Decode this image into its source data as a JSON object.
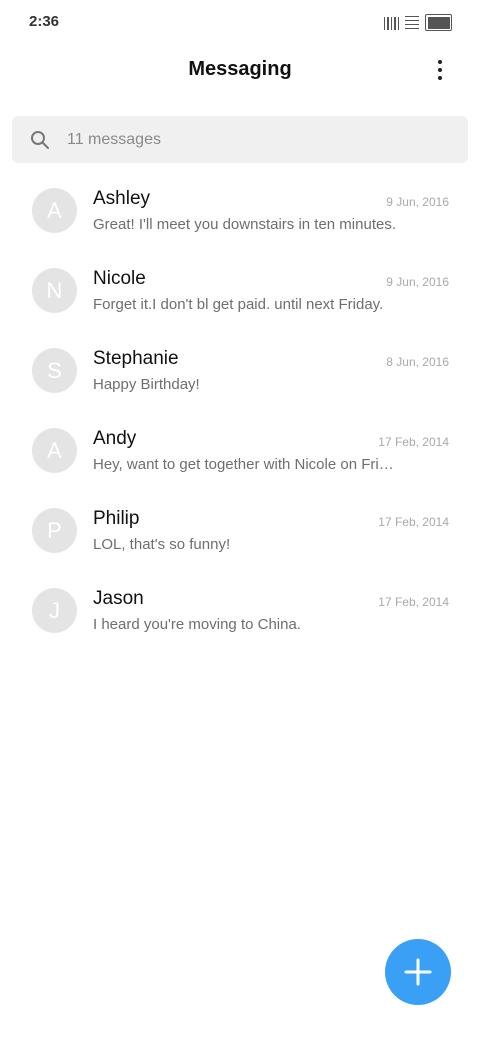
{
  "status_bar": {
    "time": "2:36",
    "icons": [
      "signal-icon",
      "wifi-icon",
      "battery-icon"
    ]
  },
  "header": {
    "title": "Messaging",
    "menu_icon": "more-vertical-icon"
  },
  "search": {
    "placeholder": "11 messages",
    "icon": "search-icon"
  },
  "messages": [
    {
      "initial": "A",
      "name": "Ashley",
      "date": "9 Jun, 2016",
      "preview": "Great! I'll meet you downstairs in ten minutes."
    },
    {
      "initial": "N",
      "name": "Nicole",
      "date": "9 Jun, 2016",
      "preview": "Forget it.I don't bl get paid. until next Friday."
    },
    {
      "initial": "S",
      "name": "Stephanie",
      "date": "8 Jun, 2016",
      "preview": "Happy Birthday!"
    },
    {
      "initial": "A",
      "name": "Andy",
      "date": "17 Feb, 2014",
      "preview": "Hey, want to get together with Nicole on Friday?"
    },
    {
      "initial": "P",
      "name": "Philip",
      "date": "17 Feb, 2014",
      "preview": "LOL, that's so funny!"
    },
    {
      "initial": "J",
      "name": "Jason",
      "date": "17 Feb, 2014",
      "preview": "I heard you're moving to China."
    }
  ],
  "fab": {
    "icon": "plus-icon"
  },
  "colors": {
    "accent": "#3aa0f5",
    "avatar_bg": "#e4e4e4",
    "search_bg": "#f0f0f0"
  }
}
